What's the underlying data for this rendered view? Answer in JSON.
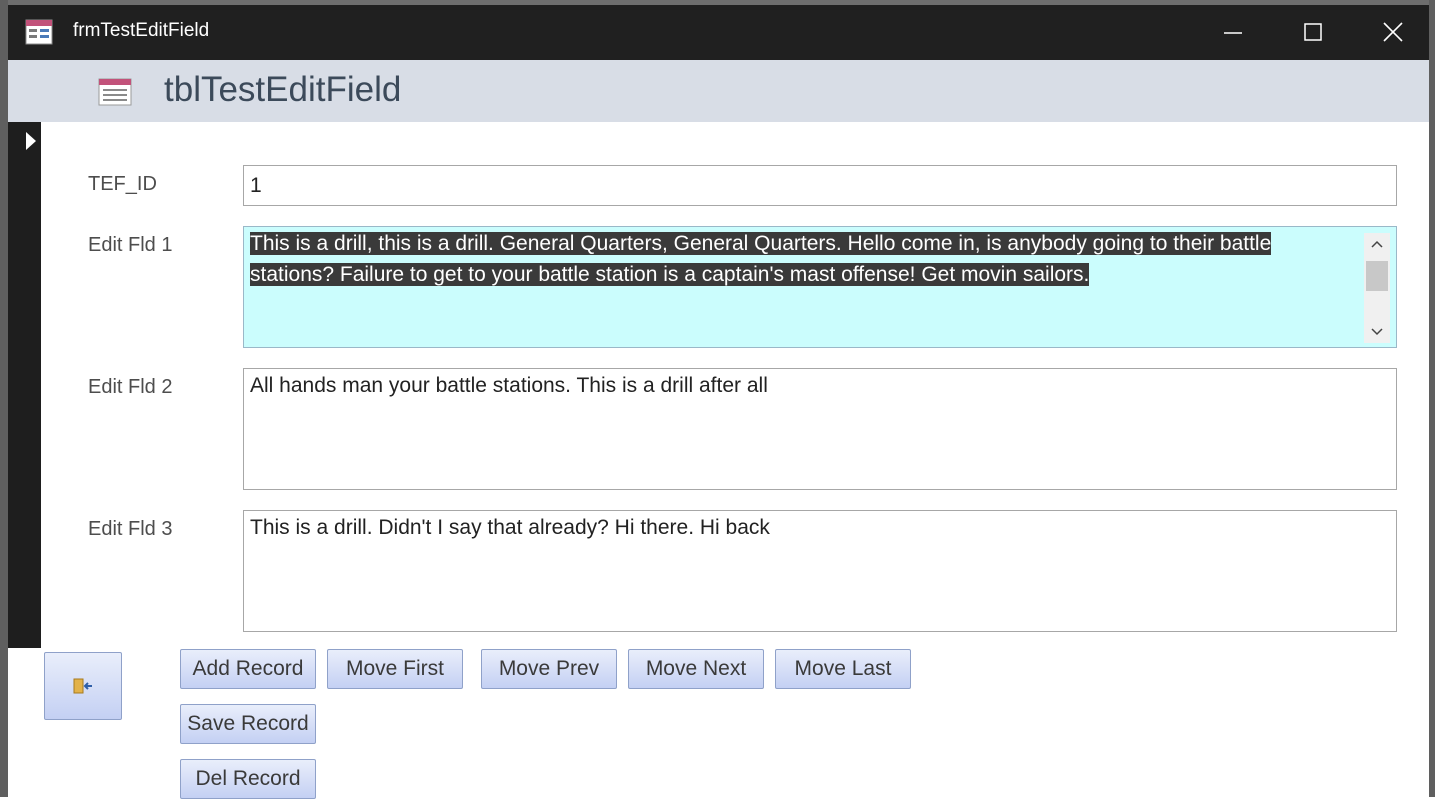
{
  "window": {
    "title": "frmTestEditField"
  },
  "header": {
    "title": "tblTestEditField"
  },
  "fields": {
    "id": {
      "label": "TEF_ID",
      "value": "1"
    },
    "edit1": {
      "label": "Edit Fld 1",
      "value": "This is a drill, this is a drill.  General Quarters, General Quarters.  Hello come in, is anybody going to their battle stations?  Failure to get to your battle station is a captain's mast offense!  Get movin sailors."
    },
    "edit2": {
      "label": "Edit Fld 2",
      "value": "All hands man your battle stations.  This is a drill after all"
    },
    "edit3": {
      "label": "Edit Fld 3",
      "value": "This is a drill.  Didn't I say that already?  Hi there.  Hi back"
    }
  },
  "buttons": {
    "add": "Add Record",
    "first": "Move First",
    "prev": "Move Prev",
    "next": "Move Next",
    "last": "Move Last",
    "save": "Save Record",
    "del": "Del Record",
    "close_icon": "exit-door-icon"
  },
  "colors": {
    "titlebar": "#202020",
    "header": "#d8dde6",
    "selected_field": "#cbfdfd",
    "button_top": "#e9eefb",
    "button_bottom": "#c4d0f3"
  }
}
